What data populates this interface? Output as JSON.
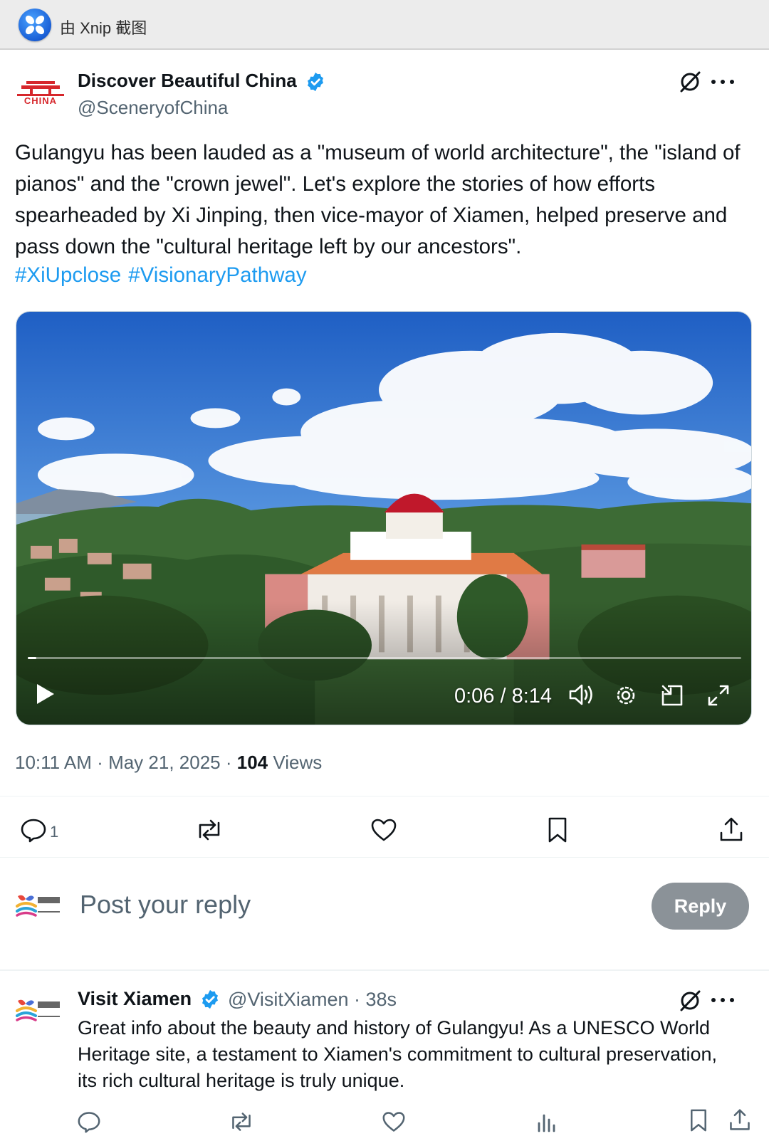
{
  "capture_bar": {
    "title": "由 Xnip 截图"
  },
  "tweet": {
    "author_name": "Discover Beautiful China",
    "author_handle": "@SceneryofChina",
    "avatar_label": "CHINA",
    "text": "Gulangyu has been lauded as a \"museum of world architecture\", the \"island of pianos\" and the \"crown jewel\". Let's explore the stories of how efforts spearheaded by Xi Jinping, then vice-mayor of Xiamen, helped preserve and pass down the \"cultural heritage left by our ancestors\".",
    "hashtags": [
      "#XiUpclose",
      "#VisionaryPathway"
    ],
    "video": {
      "time": "0:06 / 8:14",
      "progress": 0.012
    },
    "meta": {
      "time": "10:11 AM",
      "date": "May 21, 2025",
      "views": "104",
      "views_label": "Views"
    },
    "actions": {
      "reply_count": "1"
    }
  },
  "composer": {
    "placeholder": "Post your reply",
    "button": "Reply"
  },
  "reply": {
    "author_name": "Visit Xiamen",
    "author_handle": "@VisitXiamen · 38s",
    "text": "Great info about the beauty and history of Gulangyu! As a UNESCO World Heritage site, a testament to Xiamen's commitment to cultural preservation, its rich cultural heritage is truly unique."
  },
  "colors": {
    "link": "#1d9bf0",
    "verified": "#1d9bf0",
    "secondary_text": "#536471",
    "reply_button": "#8b9298"
  },
  "icons": [
    "xnip-logo-icon",
    "verified-badge-icon",
    "grok-icon",
    "more-icon",
    "play-icon",
    "volume-icon",
    "settings-icon",
    "pip-icon",
    "fullscreen-icon",
    "reply-icon",
    "repost-icon",
    "like-icon",
    "bookmark-icon",
    "share-icon",
    "views-analytics-icon"
  ]
}
